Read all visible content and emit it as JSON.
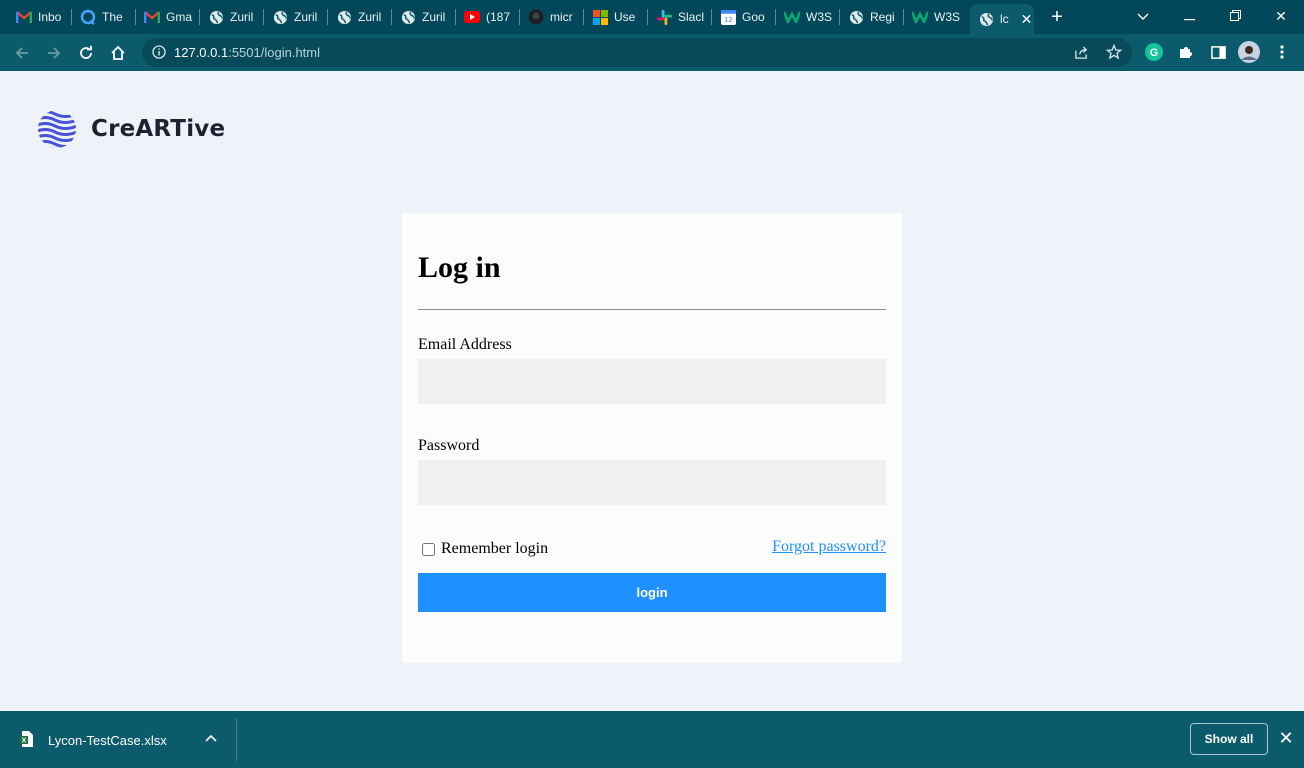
{
  "tabs": [
    {
      "label": "Inbo",
      "icon": "gmail-icon"
    },
    {
      "label": "The",
      "icon": "circle-arrow-icon"
    },
    {
      "label": "Gma",
      "icon": "gmail-icon"
    },
    {
      "label": "Zuril",
      "icon": "globe-icon"
    },
    {
      "label": "Zuril",
      "icon": "globe-icon"
    },
    {
      "label": "Zuril",
      "icon": "globe-icon"
    },
    {
      "label": "Zuril",
      "icon": "globe-icon"
    },
    {
      "label": "(187",
      "icon": "youtube-icon"
    },
    {
      "label": "micr",
      "icon": "github-icon"
    },
    {
      "label": "Use",
      "icon": "microsoft-icon"
    },
    {
      "label": "Slacl",
      "icon": "slack-icon"
    },
    {
      "label": "Goo",
      "icon": "calendar-icon"
    },
    {
      "label": "W3S",
      "icon": "w3schools-icon"
    },
    {
      "label": "Regi",
      "icon": "globe-icon"
    },
    {
      "label": "W3S",
      "icon": "w3schools-icon"
    },
    {
      "label": "lc",
      "icon": "globe-icon",
      "active": true
    }
  ],
  "address": {
    "host": "127.0.0.1",
    "path": ":5501/login.html"
  },
  "brand": {
    "name": "CreARTive"
  },
  "login": {
    "title": "Log in",
    "email_label": "Email Address",
    "email_value": "",
    "password_label": "Password",
    "password_value": "",
    "remember_label": "Remember login",
    "forgot_label": "Forgot password?",
    "submit_label": "login"
  },
  "downloads": {
    "file_name": "Lycon-TestCase.xlsx",
    "show_all": "Show all"
  },
  "colors": {
    "accent": "#1e90ff",
    "chrome": "#0c5b6c",
    "tabbar": "#03485a",
    "brand_icon": "#4a53d8",
    "page_bg": "#eef2f9"
  }
}
